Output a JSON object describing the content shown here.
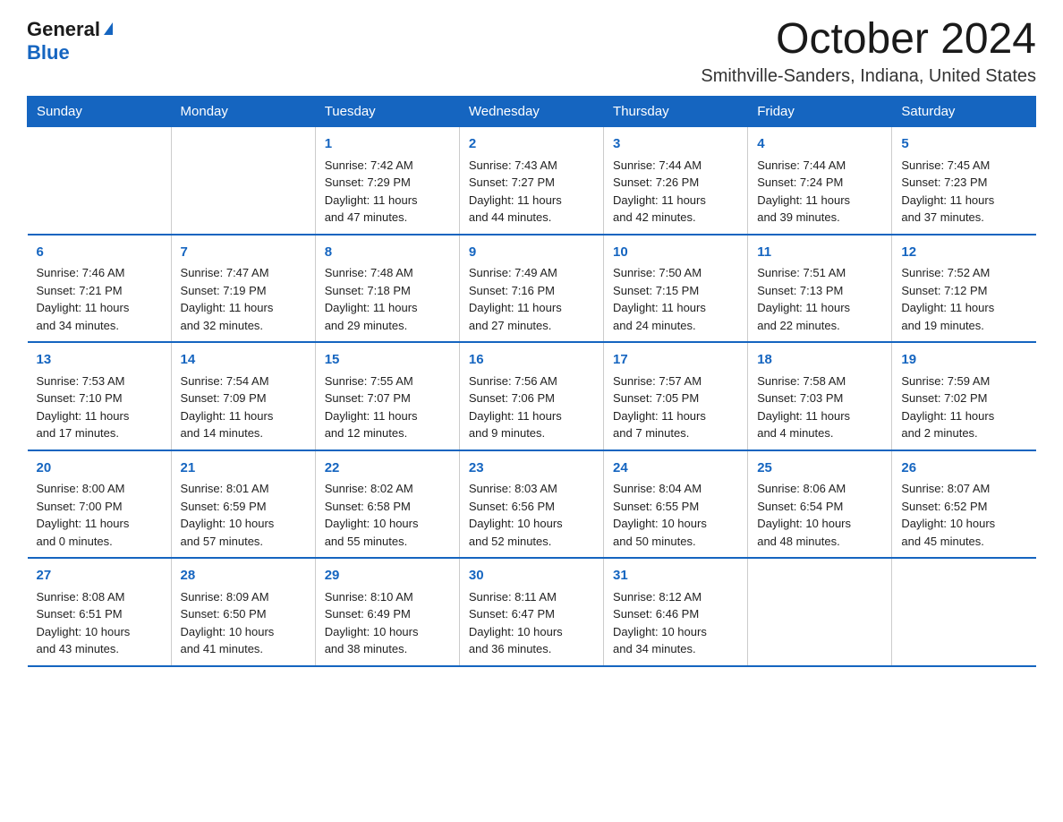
{
  "logo": {
    "general_text": "General",
    "blue_text": "Blue"
  },
  "title": {
    "month": "October 2024",
    "location": "Smithville-Sanders, Indiana, United States"
  },
  "calendar": {
    "headers": [
      "Sunday",
      "Monday",
      "Tuesday",
      "Wednesday",
      "Thursday",
      "Friday",
      "Saturday"
    ],
    "weeks": [
      [
        {
          "day": "",
          "info": ""
        },
        {
          "day": "",
          "info": ""
        },
        {
          "day": "1",
          "info": "Sunrise: 7:42 AM\nSunset: 7:29 PM\nDaylight: 11 hours\nand 47 minutes."
        },
        {
          "day": "2",
          "info": "Sunrise: 7:43 AM\nSunset: 7:27 PM\nDaylight: 11 hours\nand 44 minutes."
        },
        {
          "day": "3",
          "info": "Sunrise: 7:44 AM\nSunset: 7:26 PM\nDaylight: 11 hours\nand 42 minutes."
        },
        {
          "day": "4",
          "info": "Sunrise: 7:44 AM\nSunset: 7:24 PM\nDaylight: 11 hours\nand 39 minutes."
        },
        {
          "day": "5",
          "info": "Sunrise: 7:45 AM\nSunset: 7:23 PM\nDaylight: 11 hours\nand 37 minutes."
        }
      ],
      [
        {
          "day": "6",
          "info": "Sunrise: 7:46 AM\nSunset: 7:21 PM\nDaylight: 11 hours\nand 34 minutes."
        },
        {
          "day": "7",
          "info": "Sunrise: 7:47 AM\nSunset: 7:19 PM\nDaylight: 11 hours\nand 32 minutes."
        },
        {
          "day": "8",
          "info": "Sunrise: 7:48 AM\nSunset: 7:18 PM\nDaylight: 11 hours\nand 29 minutes."
        },
        {
          "day": "9",
          "info": "Sunrise: 7:49 AM\nSunset: 7:16 PM\nDaylight: 11 hours\nand 27 minutes."
        },
        {
          "day": "10",
          "info": "Sunrise: 7:50 AM\nSunset: 7:15 PM\nDaylight: 11 hours\nand 24 minutes."
        },
        {
          "day": "11",
          "info": "Sunrise: 7:51 AM\nSunset: 7:13 PM\nDaylight: 11 hours\nand 22 minutes."
        },
        {
          "day": "12",
          "info": "Sunrise: 7:52 AM\nSunset: 7:12 PM\nDaylight: 11 hours\nand 19 minutes."
        }
      ],
      [
        {
          "day": "13",
          "info": "Sunrise: 7:53 AM\nSunset: 7:10 PM\nDaylight: 11 hours\nand 17 minutes."
        },
        {
          "day": "14",
          "info": "Sunrise: 7:54 AM\nSunset: 7:09 PM\nDaylight: 11 hours\nand 14 minutes."
        },
        {
          "day": "15",
          "info": "Sunrise: 7:55 AM\nSunset: 7:07 PM\nDaylight: 11 hours\nand 12 minutes."
        },
        {
          "day": "16",
          "info": "Sunrise: 7:56 AM\nSunset: 7:06 PM\nDaylight: 11 hours\nand 9 minutes."
        },
        {
          "day": "17",
          "info": "Sunrise: 7:57 AM\nSunset: 7:05 PM\nDaylight: 11 hours\nand 7 minutes."
        },
        {
          "day": "18",
          "info": "Sunrise: 7:58 AM\nSunset: 7:03 PM\nDaylight: 11 hours\nand 4 minutes."
        },
        {
          "day": "19",
          "info": "Sunrise: 7:59 AM\nSunset: 7:02 PM\nDaylight: 11 hours\nand 2 minutes."
        }
      ],
      [
        {
          "day": "20",
          "info": "Sunrise: 8:00 AM\nSunset: 7:00 PM\nDaylight: 11 hours\nand 0 minutes."
        },
        {
          "day": "21",
          "info": "Sunrise: 8:01 AM\nSunset: 6:59 PM\nDaylight: 10 hours\nand 57 minutes."
        },
        {
          "day": "22",
          "info": "Sunrise: 8:02 AM\nSunset: 6:58 PM\nDaylight: 10 hours\nand 55 minutes."
        },
        {
          "day": "23",
          "info": "Sunrise: 8:03 AM\nSunset: 6:56 PM\nDaylight: 10 hours\nand 52 minutes."
        },
        {
          "day": "24",
          "info": "Sunrise: 8:04 AM\nSunset: 6:55 PM\nDaylight: 10 hours\nand 50 minutes."
        },
        {
          "day": "25",
          "info": "Sunrise: 8:06 AM\nSunset: 6:54 PM\nDaylight: 10 hours\nand 48 minutes."
        },
        {
          "day": "26",
          "info": "Sunrise: 8:07 AM\nSunset: 6:52 PM\nDaylight: 10 hours\nand 45 minutes."
        }
      ],
      [
        {
          "day": "27",
          "info": "Sunrise: 8:08 AM\nSunset: 6:51 PM\nDaylight: 10 hours\nand 43 minutes."
        },
        {
          "day": "28",
          "info": "Sunrise: 8:09 AM\nSunset: 6:50 PM\nDaylight: 10 hours\nand 41 minutes."
        },
        {
          "day": "29",
          "info": "Sunrise: 8:10 AM\nSunset: 6:49 PM\nDaylight: 10 hours\nand 38 minutes."
        },
        {
          "day": "30",
          "info": "Sunrise: 8:11 AM\nSunset: 6:47 PM\nDaylight: 10 hours\nand 36 minutes."
        },
        {
          "day": "31",
          "info": "Sunrise: 8:12 AM\nSunset: 6:46 PM\nDaylight: 10 hours\nand 34 minutes."
        },
        {
          "day": "",
          "info": ""
        },
        {
          "day": "",
          "info": ""
        }
      ]
    ]
  }
}
